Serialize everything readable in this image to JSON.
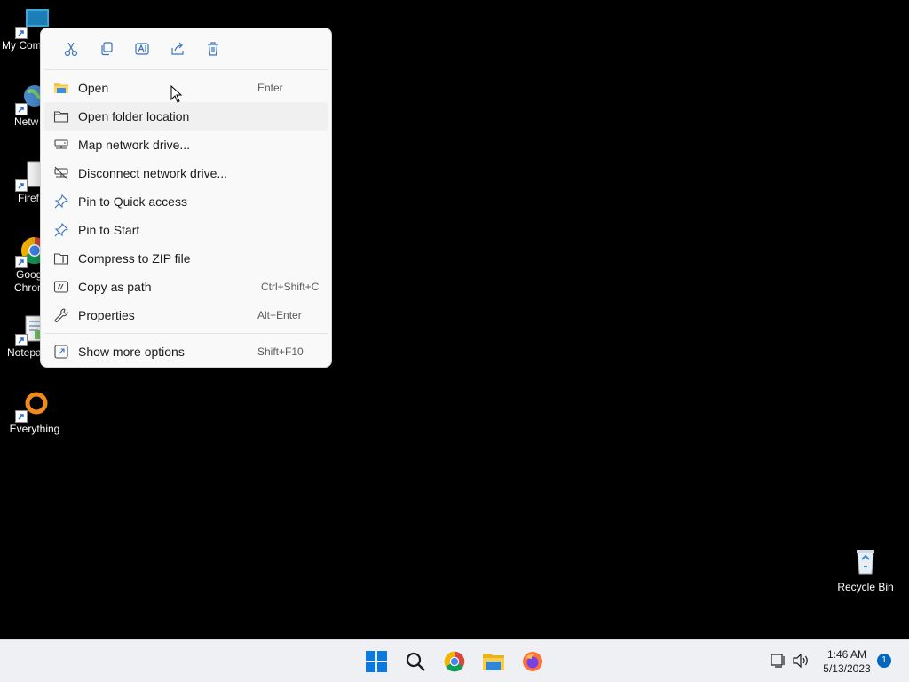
{
  "desktop": {
    "icons": [
      {
        "label": "My Com",
        "icon": "computer-icon"
      },
      {
        "label": "Netw",
        "icon": "network-icon"
      },
      {
        "label": "Firef",
        "icon": "file-icon"
      },
      {
        "label": "Goog",
        "label2": "Chron",
        "icon": "chrome-icon"
      },
      {
        "label": "Notepa",
        "icon": "notepad-icon"
      },
      {
        "label": "Everything",
        "icon": "everything-icon"
      }
    ],
    "recycle_bin": {
      "label": "Recycle Bin",
      "icon": "recycle-bin-icon"
    }
  },
  "context_menu": {
    "toolbar": [
      {
        "name": "cut",
        "icon": "scissors-icon"
      },
      {
        "name": "copy",
        "icon": "copy-icon"
      },
      {
        "name": "rename",
        "icon": "rename-icon"
      },
      {
        "name": "share",
        "icon": "share-icon"
      },
      {
        "name": "delete",
        "icon": "trash-icon"
      }
    ],
    "items": [
      {
        "label": "Open",
        "shortcut": "Enter",
        "icon": "folder-yellow-icon"
      },
      {
        "label": "Open folder location",
        "shortcut": "",
        "icon": "folder-outline-icon"
      },
      {
        "label": "Map network drive...",
        "shortcut": "",
        "icon": "network-drive-icon"
      },
      {
        "label": "Disconnect network drive...",
        "shortcut": "",
        "icon": "disconnect-drive-icon"
      },
      {
        "label": "Pin to Quick access",
        "shortcut": "",
        "icon": "pin-icon"
      },
      {
        "label": "Pin to Start",
        "shortcut": "",
        "icon": "pin-icon"
      },
      {
        "label": "Compress to ZIP file",
        "shortcut": "",
        "icon": "zip-icon"
      },
      {
        "label": "Copy as path",
        "shortcut": "Ctrl+Shift+C",
        "icon": "copy-path-icon"
      },
      {
        "label": "Properties",
        "shortcut": "Alt+Enter",
        "icon": "wrench-icon"
      }
    ],
    "more": {
      "label": "Show more options",
      "shortcut": "Shift+F10",
      "icon": "more-options-icon"
    }
  },
  "taskbar": {
    "apps": [
      "start-icon",
      "search-icon",
      "chrome-icon",
      "file-explorer-icon",
      "firefox-icon"
    ],
    "tray": [
      "network-icon",
      "volume-icon"
    ],
    "time": "1:46 AM",
    "date": "5/13/2023",
    "notification_count": "1"
  },
  "colors": {
    "accent": "#0067c0",
    "icon_blue": "#3b74b8",
    "folder_yellow": "#f4c542"
  }
}
